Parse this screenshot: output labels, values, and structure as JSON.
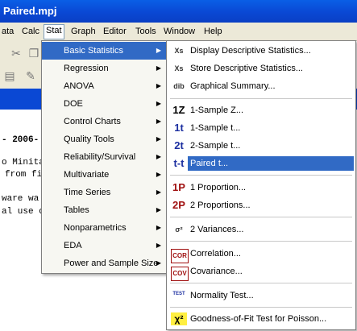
{
  "window": {
    "title": "Paired.mpj"
  },
  "menubar": {
    "items": [
      "ata",
      "Calc",
      "Stat",
      "Graph",
      "Editor",
      "Tools",
      "Window",
      "Help"
    ],
    "active": "Stat"
  },
  "session": {
    "lines": [
      "- 2006-",
      "o Minita",
      "from fi",
      "ware wa",
      "al use o"
    ]
  },
  "stat_menu": {
    "items": [
      "Basic Statistics",
      "Regression",
      "ANOVA",
      "DOE",
      "Control Charts",
      "Quality Tools",
      "Reliability/Survival",
      "Multivariate",
      "Time Series",
      "Tables",
      "Nonparametrics",
      "EDA",
      "Power and Sample Size"
    ],
    "selected": "Basic Statistics"
  },
  "basic_stats_menu": {
    "items": [
      {
        "icon": "Xs",
        "label": "Display Descriptive Statistics..."
      },
      {
        "icon": "Xs",
        "label": "Store Descriptive Statistics..."
      },
      {
        "icon": "dib",
        "label": "Graphical Summary..."
      },
      {
        "icon": "1Z",
        "label": "1-Sample Z..."
      },
      {
        "icon": "1t",
        "label": "1-Sample t..."
      },
      {
        "icon": "2t",
        "label": "2-Sample t..."
      },
      {
        "icon": "t-t",
        "label": "Paired t..."
      },
      {
        "icon": "1P",
        "label": "1 Proportion..."
      },
      {
        "icon": "2P",
        "label": "2 Proportions..."
      },
      {
        "icon": "σ²",
        "label": "2 Variances..."
      },
      {
        "icon": "COR",
        "label": "Correlation..."
      },
      {
        "icon": "COV",
        "label": "Covariance..."
      },
      {
        "icon": "TEST",
        "label": "Normality Test..."
      },
      {
        "icon": "χ²",
        "label": "Goodness-of-Fit Test for Poisson..."
      }
    ],
    "selected": "Paired t..."
  },
  "colors": {
    "title_bar": "#0a48d4",
    "selection": "#316ac5",
    "menu_bg": "#ece9d8"
  }
}
